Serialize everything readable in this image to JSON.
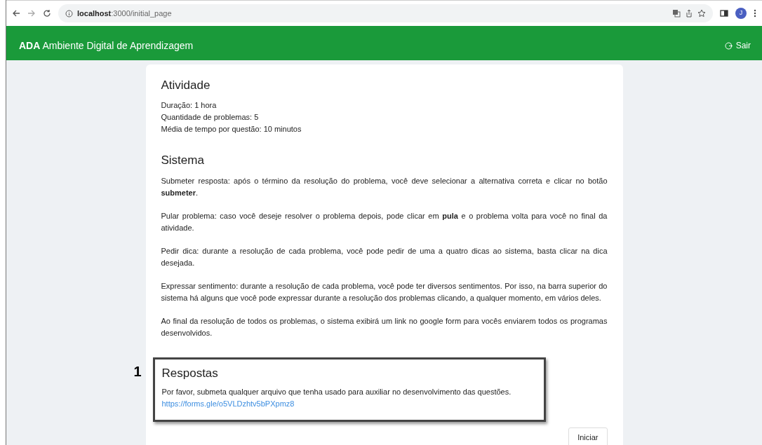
{
  "browser": {
    "url_host": "localhost",
    "url_path": ":3000/initial_page",
    "profile_initial": "J"
  },
  "navbar": {
    "brand_bold": "ADA",
    "brand_rest": "Ambiente Digital de Aprendizagem",
    "logout": "Sair"
  },
  "sections": [
    {
      "kind": "lines",
      "title": "Atividade",
      "texts": [
        "Duração: 1 hora",
        "Quantidade de problemas: 5",
        "Média de tempo por questão: 10 minutos"
      ]
    },
    {
      "kind": "paragraphs",
      "title": "Sistema",
      "texts": [
        "Submeter resposta: após o término da resolução do problema, você deve selecionar a alternativa correta e clicar no botão **submeter**.",
        "Pular problema: caso você deseje resolver o problema depois, pode clicar em **pula** e o problema volta para você no final da atividade.",
        "Pedir dica: durante a resolução de cada problema, você pode pedir de uma a quatro dicas ao sistema, basta clicar na dica desejada.",
        "Expressar sentimento: durante a resolução de cada problema, você pode ter diversos sentimentos. Por isso, na barra superior do sistema há alguns que você pode expressar durante a resolução dos problemas clicando, a qualquer momento, em vários deles.",
        "Ao final da resolução de todos os problemas, o sistema exibirá um link no google form para vocês enviarem todos os programas desenvolvidos."
      ]
    },
    {
      "kind": "callout",
      "title": "Respostas",
      "callout_number": "1",
      "texts": [
        "Por favor, submeta qualquer arquivo que tenha usado para auxiliar no desenvolvimento das questões."
      ],
      "link": "https://forms.gle/o5VLDzhtv5bPXpmz8"
    }
  ],
  "start_button": "Iniciar"
}
